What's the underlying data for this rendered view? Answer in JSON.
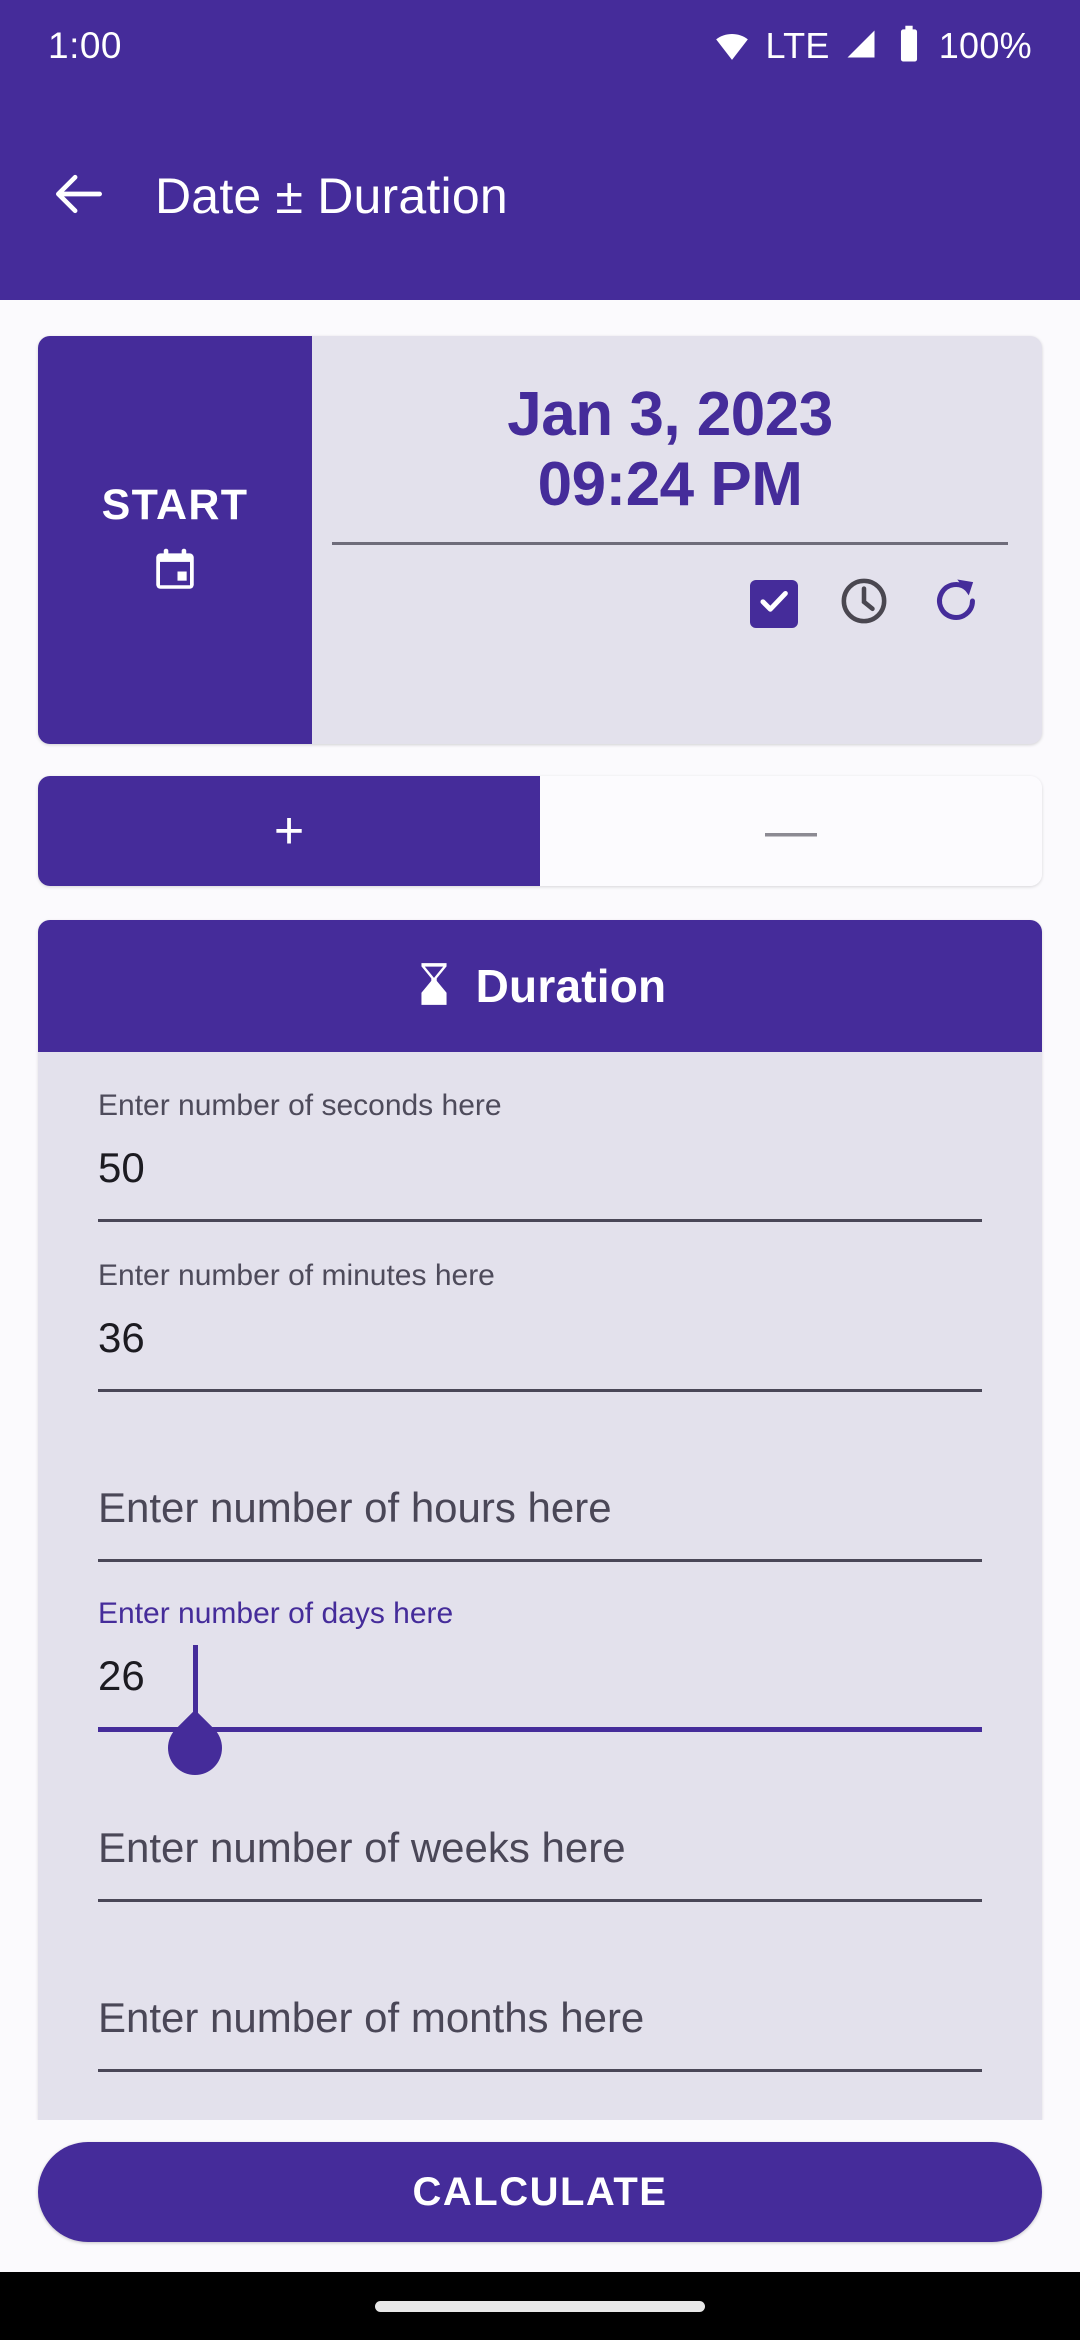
{
  "status_bar": {
    "time": "1:00",
    "network": "LTE",
    "battery": "100%",
    "wifi_icon": "wifi-icon",
    "signal_icon": "cellular-signal-icon",
    "battery_icon": "battery-full-icon"
  },
  "app_bar": {
    "back_icon": "back-arrow-icon",
    "title": "Date ± Duration"
  },
  "date_card": {
    "start_label": "START",
    "start_icon": "calendar-icon",
    "date": "Jan 3, 2023",
    "time": "09:24 PM",
    "checkbox_checked": true,
    "checkbox_icon": "checkbox-checked-icon",
    "clock_icon": "clock-icon",
    "refresh_icon": "refresh-icon"
  },
  "operation_toggle": {
    "plus_label": "+",
    "minus_label": "—",
    "selected": "plus"
  },
  "duration": {
    "header_icon": "hourglass-icon",
    "header_title": "Duration",
    "fields": [
      {
        "name": "seconds",
        "placeholder": "Enter number of seconds here",
        "value": "50",
        "focused": false
      },
      {
        "name": "minutes",
        "placeholder": "Enter number of minutes here",
        "value": "36",
        "focused": false
      },
      {
        "name": "hours",
        "placeholder": "Enter number of hours here",
        "value": "",
        "focused": false
      },
      {
        "name": "days",
        "placeholder": "Enter number of days here",
        "value": "26",
        "focused": true
      },
      {
        "name": "weeks",
        "placeholder": "Enter number of weeks here",
        "value": "",
        "focused": false
      },
      {
        "name": "months",
        "placeholder": "Enter number of months here",
        "value": "",
        "focused": false
      }
    ]
  },
  "calculate_button": {
    "label": "CALCULATE"
  },
  "colors": {
    "primary_purple": "#452C9A",
    "card_surface": "#E3E1EC",
    "page_background": "#FBFAFD",
    "divider": "#4A4757",
    "clock_icon": "#4A4750"
  }
}
